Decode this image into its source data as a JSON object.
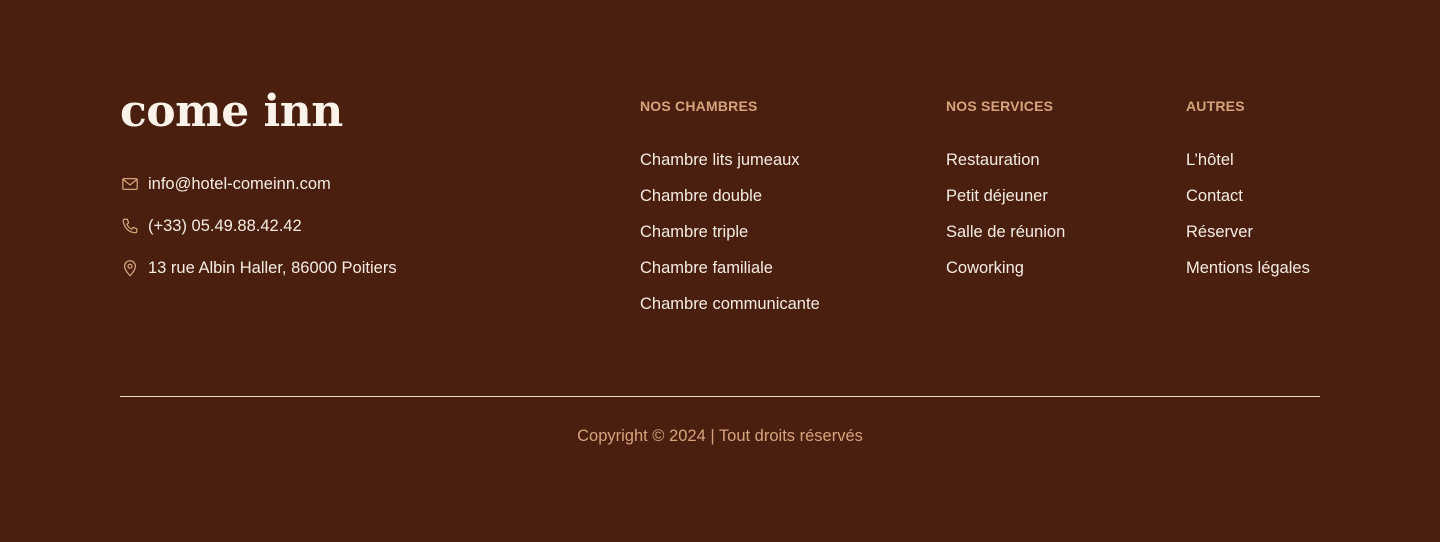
{
  "brand": {
    "logo_text": "come inn"
  },
  "contact": {
    "email": {
      "icon": "mail-icon",
      "text": "info@hotel-comeinn.com"
    },
    "phone": {
      "icon": "phone-icon",
      "text": "(+33) 05.49.88.42.42"
    },
    "address": {
      "icon": "location-pin-icon",
      "text": "13 rue Albin Haller, 86000 Poitiers"
    }
  },
  "columns": [
    {
      "title": "NOS CHAMBRES",
      "links": [
        "Chambre lits jumeaux",
        "Chambre double",
        "Chambre triple",
        "Chambre familiale",
        "Chambre communicante"
      ]
    },
    {
      "title": "NOS SERVICES",
      "links": [
        "Restauration",
        "Petit déjeuner",
        "Salle de réunion",
        "Coworking"
      ]
    },
    {
      "title": "AUTRES",
      "links": [
        "L’hôtel",
        "Contact",
        "Réserver",
        "Mentions légales"
      ]
    }
  ],
  "copyright": "Copyright © 2024 | Tout droits réservés",
  "colors": {
    "background": "#4a1f0f",
    "accent": "#d6a37c",
    "text": "#f5ece4"
  }
}
